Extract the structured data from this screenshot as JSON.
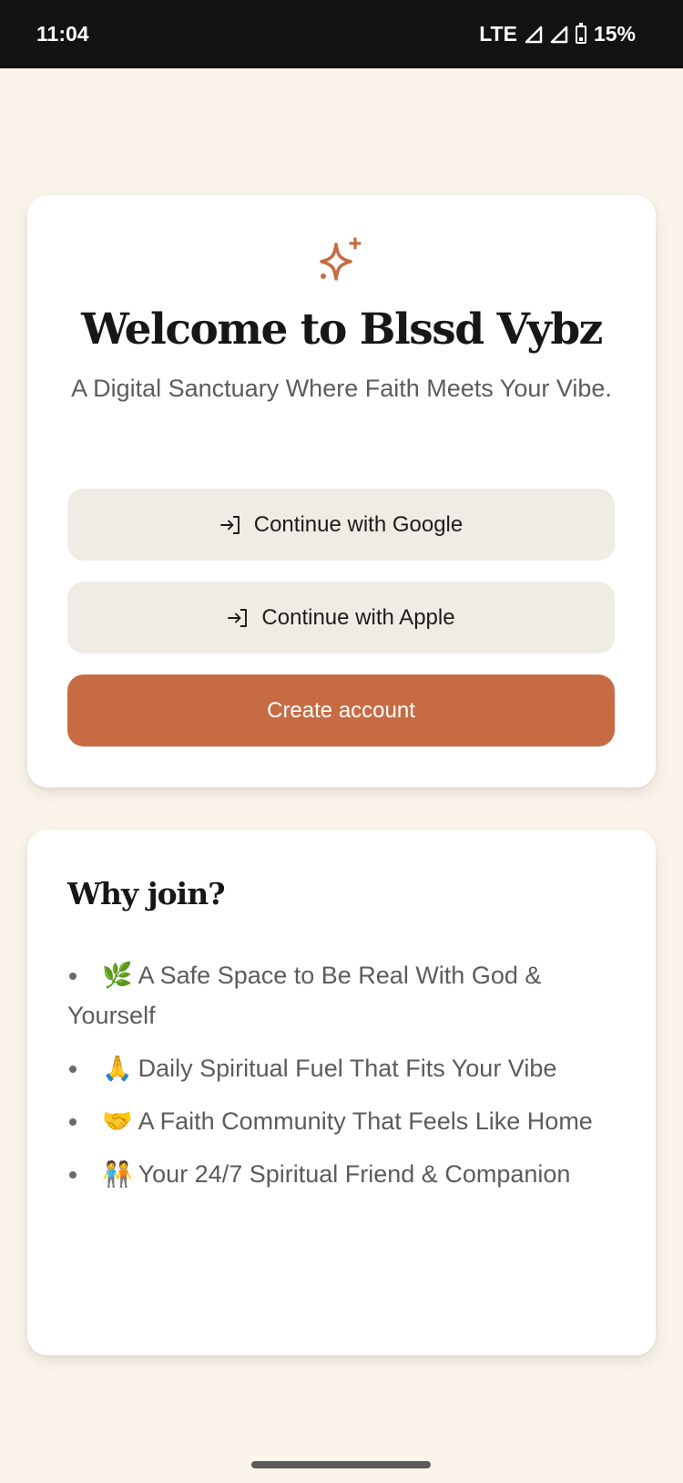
{
  "status_bar": {
    "time": "11:04",
    "network": "LTE",
    "battery": "15%",
    "icons": [
      "signal-icon",
      "signal-icon",
      "battery-icon"
    ]
  },
  "welcome": {
    "icon": "sparkle-icon",
    "title": "Welcome to Blssd Vybz",
    "tagline": "A Digital Sanctuary Where Faith Meets Your Vibe.",
    "buttons": {
      "google": {
        "label": "Continue with Google",
        "icon": "login-icon"
      },
      "apple": {
        "label": "Continue with Apple",
        "icon": "login-icon"
      },
      "create": {
        "label": "Create account"
      }
    }
  },
  "why_join": {
    "title": "Why join?",
    "items": [
      {
        "emoji": "🌿",
        "text": "A Safe Space to Be Real With God & Yourself"
      },
      {
        "emoji": "🙏",
        "text": "Daily Spiritual Fuel That Fits Your Vibe"
      },
      {
        "emoji": "🤝",
        "text": "A Faith Community That Feels Like Home"
      },
      {
        "emoji": "🧑‍🤝‍🧑",
        "text": "Your 24/7 Spiritual Friend & Companion"
      }
    ]
  },
  "colors": {
    "background": "#faf4ea",
    "accent": "#c76b43",
    "secondary_button": "#efece5",
    "title_text": "#171717",
    "body_text": "#5c5c5c"
  }
}
